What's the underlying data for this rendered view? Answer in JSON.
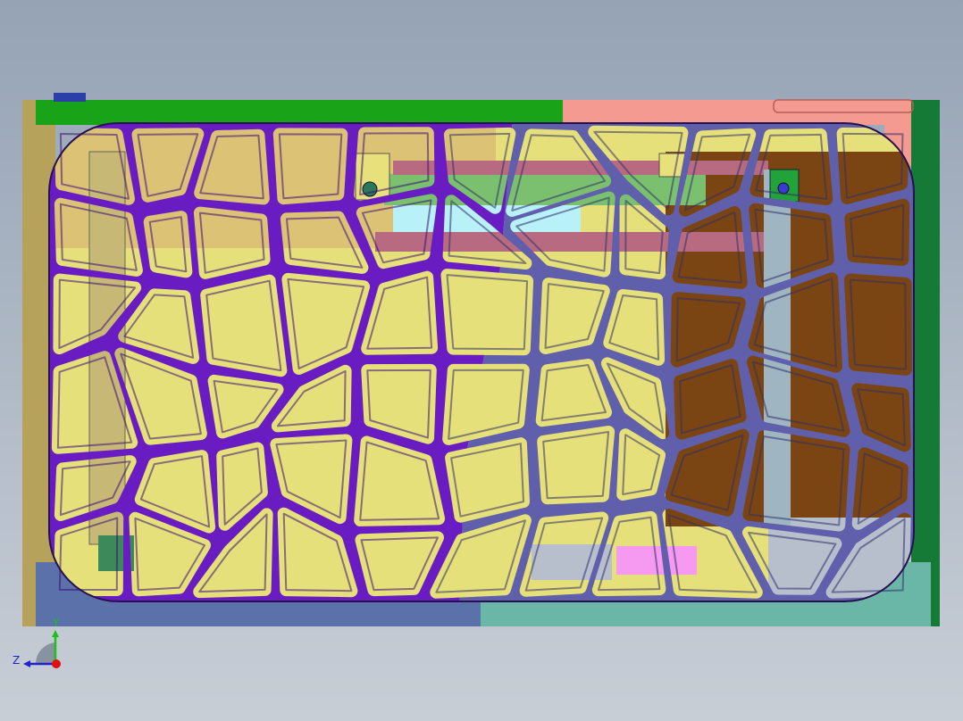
{
  "viewport": {
    "background_top": "#95a3b5",
    "background_bottom": "#c8ced6"
  },
  "model": {
    "colors": {
      "frame_left_green": "#19a319",
      "frame_right_pink": "#f49a90",
      "frame_right_green": "#157a35",
      "frame_tan": "#b6a25a",
      "frame_bottom_blue": "#5a71a9",
      "frame_bottom_teal": "#6ab7a7",
      "grille_purple": "#6a1cc3",
      "grille_purple_edge": "#3c0c7a",
      "grille_slate": "#5f5fac",
      "grille_slate_edge": "#2f2f6a",
      "interior_yellow": "#e6e07a",
      "interior_brown": "#7a4512",
      "interior_cyan": "#b8f2f8",
      "interior_green": "#7bc06e",
      "interior_maroon": "#b86a80",
      "interior_pink": "#f59af0",
      "interior_gray": "#b7bfcd"
    }
  },
  "triad": {
    "y_label": "Y",
    "z_label": "Z",
    "y_color": "#19c219",
    "z_color": "#2222cc",
    "x_color": "#e01010"
  }
}
